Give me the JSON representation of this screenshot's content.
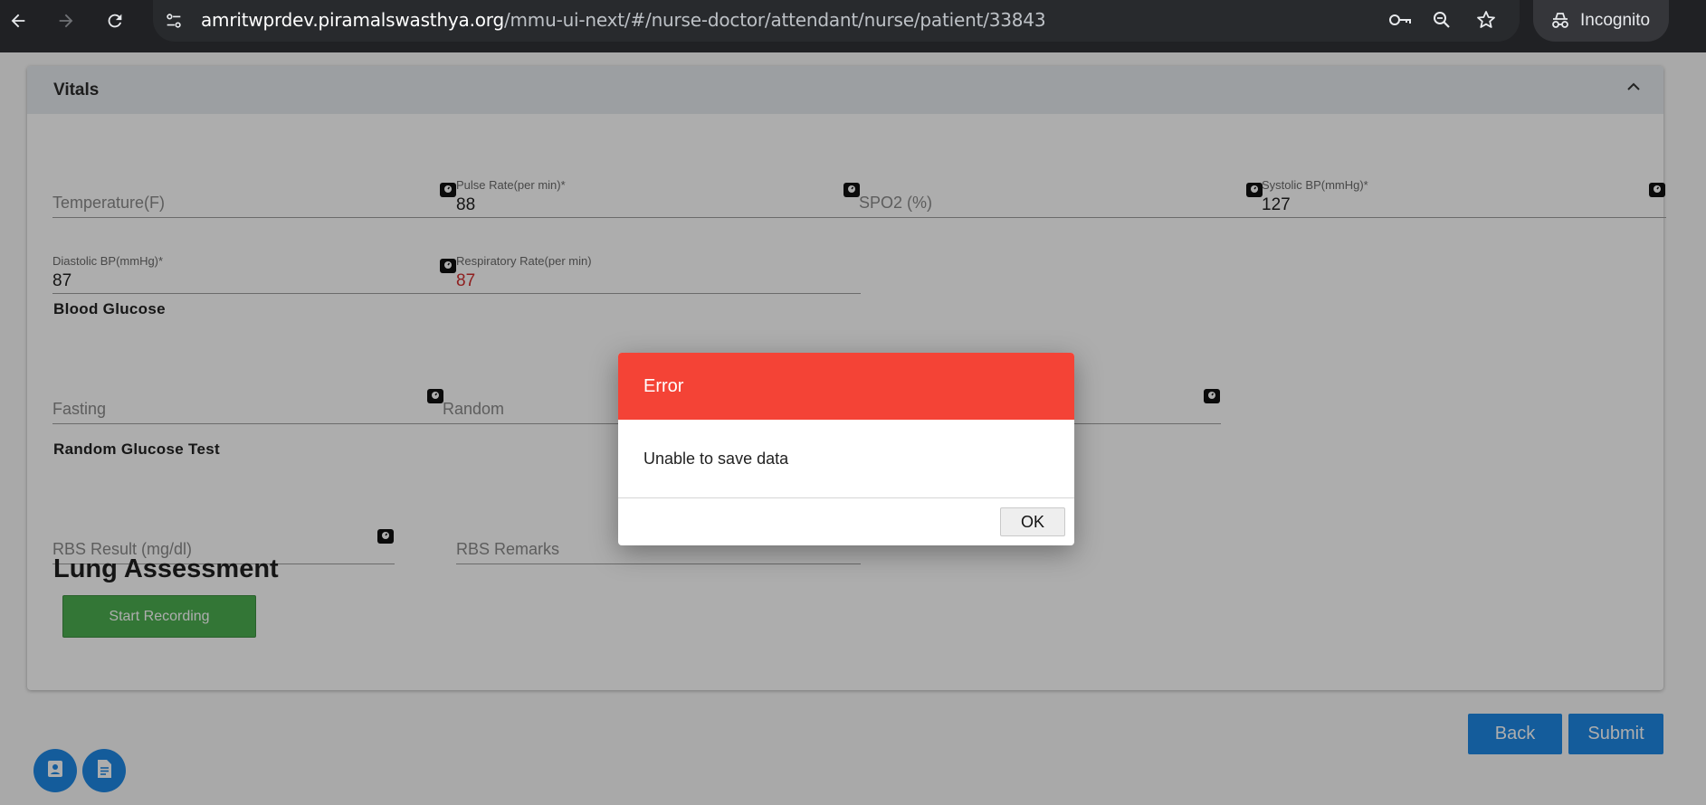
{
  "browser": {
    "url_host": "amritwprdev.piramalswasthya.org",
    "url_path": "/mmu-ui-next/#/nurse-doctor/attendant/nurse/patient/33843",
    "incognito_label": "Incognito",
    "icons": [
      "back-arrow-icon",
      "forward-arrow-icon",
      "reload-icon",
      "site-info-icon",
      "key-icon",
      "zoom-icon",
      "star-icon",
      "incognito-icon"
    ]
  },
  "vitals": {
    "title": "Vitals",
    "temperature": {
      "placeholder": "Temperature(F)"
    },
    "pulse_rate": {
      "label": "Pulse Rate(per min)*",
      "value": "88"
    },
    "spo2": {
      "placeholder": "SPO2 (%)"
    },
    "systolic_bp": {
      "label": "Systolic BP(mmHg)*",
      "value": "127"
    },
    "diastolic_bp": {
      "label": "Diastolic BP(mmHg)*",
      "value": "87"
    },
    "respiratory_rate": {
      "label": "Respiratory Rate(per min)",
      "value": "87"
    },
    "blood_glucose": {
      "title": "Blood Glucose",
      "fasting": {
        "placeholder": "Fasting"
      },
      "random": {
        "placeholder": "Random"
      }
    },
    "rbs": {
      "title": "Random Glucose Test",
      "result": {
        "placeholder": "RBS Result (mg/dl)"
      },
      "remarks": {
        "placeholder": "RBS Remarks"
      }
    },
    "lung": {
      "title": "Lung Assessment",
      "record_label": "Start Recording"
    }
  },
  "actions": {
    "back_label": "Back",
    "submit_label": "Submit"
  },
  "dialog": {
    "title": "Error",
    "message": "Unable to save data",
    "ok_label": "OK"
  },
  "colors": {
    "primary": "#1e88e5",
    "error_header": "#f44336",
    "record_button": "#4caf50",
    "error_text": "#d32f2f"
  }
}
